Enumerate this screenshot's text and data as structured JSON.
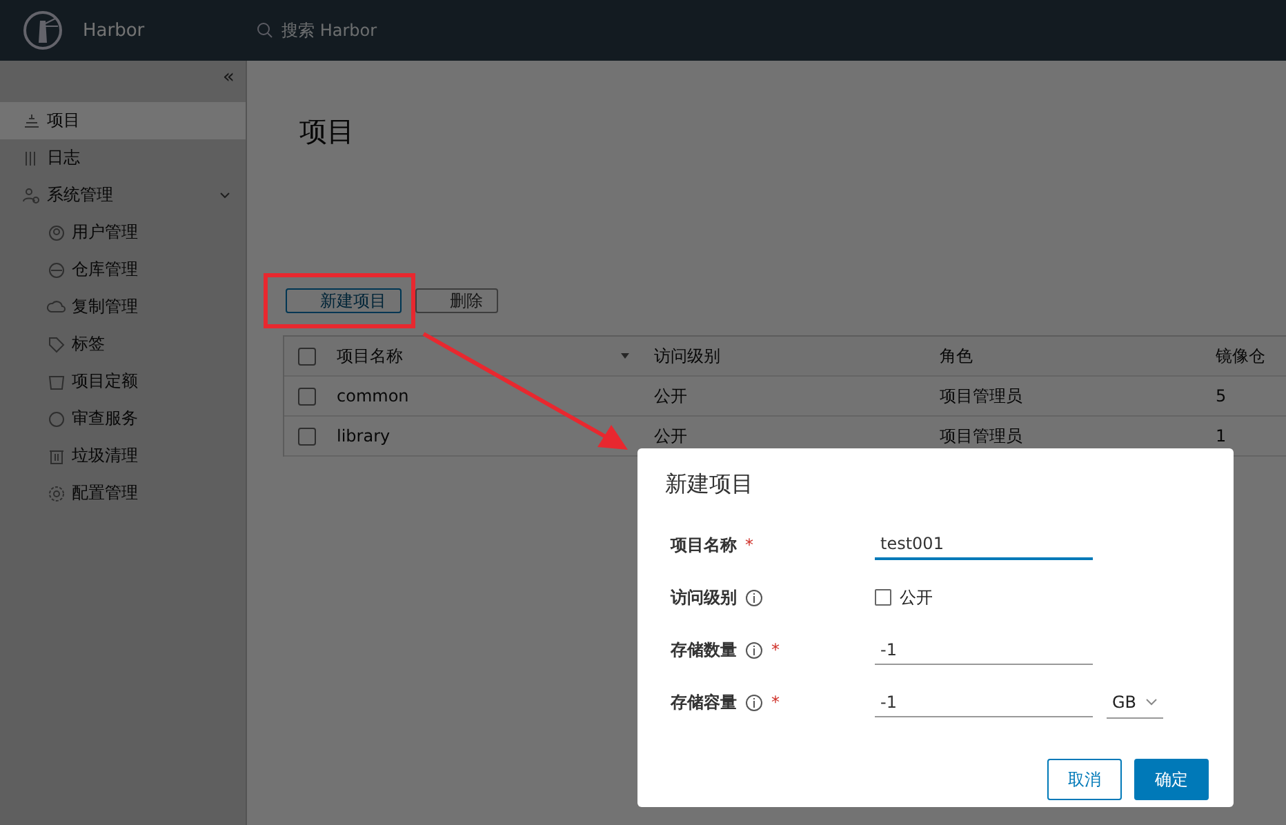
{
  "header": {
    "brand": "Harbor",
    "search": {
      "placeholder": "搜索 Harbor"
    }
  },
  "sidebar": {
    "collapse": "«",
    "items": [
      {
        "label": "项目",
        "selected": true
      },
      {
        "label": "日志",
        "selected": false
      },
      {
        "label": "系统管理",
        "selected": false,
        "expanded": true,
        "children": [
          {
            "label": "用户管理",
            "selected": false
          },
          {
            "label": "仓库管理",
            "selected": false
          },
          {
            "label": "复制管理",
            "selected": false
          },
          {
            "label": "标签",
            "selected": false
          },
          {
            "label": "项目定额",
            "selected": false
          },
          {
            "label": "审查服务",
            "selected": false
          },
          {
            "label": "垃圾清理",
            "selected": false
          },
          {
            "label": "配置管理",
            "selected": false
          }
        ]
      }
    ]
  },
  "page": {
    "title": "项目",
    "buttons": [
      {
        "label": "新建项目",
        "disabled": false,
        "highlighted": true
      },
      {
        "label": "删除",
        "disabled": true,
        "highlighted": false
      }
    ]
  },
  "table": {
    "select_all": {
      "checked": false
    },
    "columns": [
      "项目名称",
      "访问级别",
      "角色",
      "镜像仓"
    ],
    "rows": [
      {
        "checked": false,
        "cells": [
          "common",
          "公开",
          "项目管理员",
          "5"
        ]
      },
      {
        "checked": false,
        "cells": [
          "library",
          "公开",
          "项目管理员",
          "1"
        ]
      }
    ]
  },
  "dialog": {
    "title": "新建项目",
    "fields": [
      {
        "kind": "text",
        "label": "项目名称",
        "info": false,
        "required_mark": "*",
        "value": "test001",
        "focused": true
      },
      {
        "kind": "checkbox",
        "label": "访问级别",
        "info": true,
        "option": "公开",
        "checked": false
      },
      {
        "kind": "text",
        "label": "存储数量",
        "info": true,
        "required_mark": "*",
        "value": "-1",
        "focused": false
      },
      {
        "kind": "unit",
        "label": "存储容量",
        "info": true,
        "required_mark": "*",
        "value": "-1",
        "focused": false,
        "unit": "GB"
      }
    ],
    "buttons": [
      {
        "label": "取消",
        "primary": false
      },
      {
        "label": "确定",
        "primary": true
      }
    ]
  }
}
